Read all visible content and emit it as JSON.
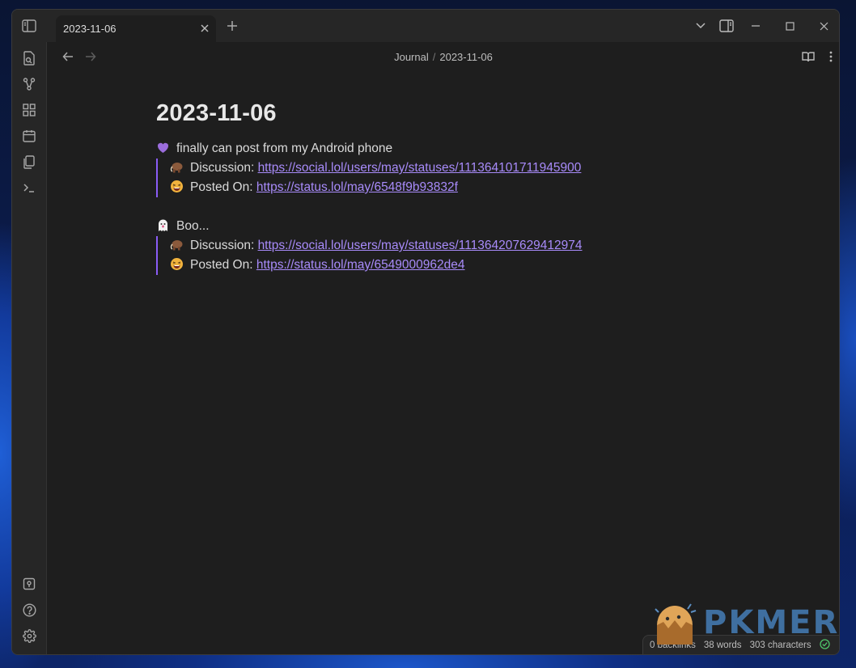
{
  "tab": {
    "title": "2023-11-06"
  },
  "breadcrumb": {
    "folder": "Journal",
    "separator": "/",
    "note": "2023-11-06"
  },
  "note": {
    "title": "2023-11-06",
    "entries": [
      {
        "emoji": "purple-heart",
        "text": "finally can post from my Android phone",
        "discussion_label": "Discussion:",
        "discussion_url": "https://social.lol/users/may/statuses/111364101711945900",
        "posted_label": "Posted On:",
        "posted_url": "https://status.lol/may/6548f9b93832f"
      },
      {
        "emoji": "ghost",
        "text": "Boo...",
        "discussion_label": "Discussion:",
        "discussion_url": "https://social.lol/users/may/statuses/111364207629412974",
        "posted_label": "Posted On:",
        "posted_url": "https://status.lol/may/6549000962de4"
      }
    ]
  },
  "status": {
    "backlinks": "0 backlinks",
    "words": "38 words",
    "characters": "303 characters"
  },
  "watermark": {
    "text": "PKMER"
  },
  "colors": {
    "accent": "#8a5cf5",
    "link": "#a88bfa",
    "background": "#1e1e1e"
  }
}
